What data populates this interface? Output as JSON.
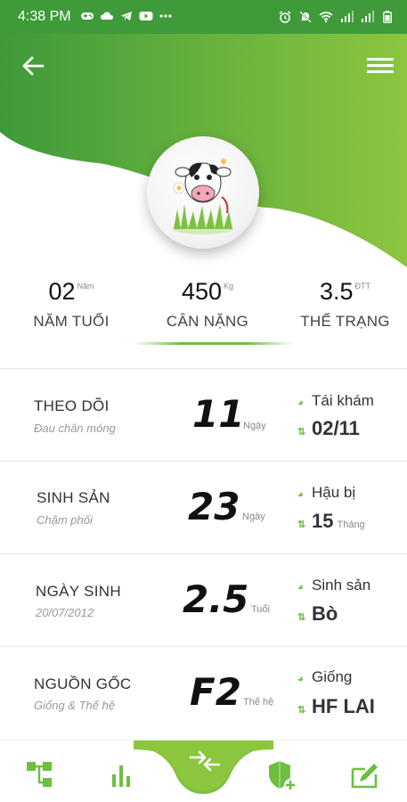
{
  "status_bar": {
    "time": "4:38 PM"
  },
  "colors": {
    "primary_green": "#6cbf3f",
    "dark_green": "#3f9a3a",
    "text_dark": "#111111"
  },
  "stats": [
    {
      "value": "02",
      "unit": "Năm",
      "label": "NĂM TUỔI"
    },
    {
      "value": "450",
      "unit": "Kg",
      "label": "CÂN NẶNG"
    },
    {
      "value": "3.5",
      "unit": "ĐTT",
      "label": "THỂ TRẠNG"
    }
  ],
  "rows": [
    {
      "title": "THEO DÕI",
      "subtitle": "Đau chân móng",
      "big_value": "11",
      "big_unit": "Ngày",
      "right_label": "Tái khám",
      "right_value": "02/11",
      "right_unit": ""
    },
    {
      "title": "SINH SẢN",
      "subtitle": "Chậm phối",
      "big_value": "23",
      "big_unit": "Ngày",
      "right_label": "Hậu bị",
      "right_value": "15",
      "right_unit": "Tháng"
    },
    {
      "title": "NGÀY SINH",
      "subtitle": "20/07/2012",
      "big_value": "2.5",
      "big_unit": "Tuổi",
      "right_label": "Sinh sản",
      "right_value": "Bò",
      "right_unit": ""
    },
    {
      "title": "NGUỒN GỐC",
      "subtitle": "Giống & Thế hệ",
      "big_value": "F2",
      "big_unit": "Thế hệ",
      "right_label": "Giống",
      "right_value": "HF LAI",
      "right_unit": ""
    }
  ],
  "icons": {
    "back": "arrow-left-icon",
    "menu": "hamburger-menu-icon",
    "nav": [
      "hierarchy-icon",
      "bar-chart-icon",
      "compare-arrows-icon",
      "shield-add-icon",
      "edit-box-icon"
    ]
  }
}
